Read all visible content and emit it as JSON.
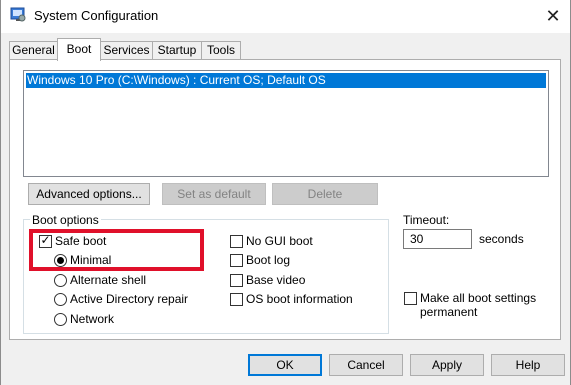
{
  "window": {
    "title": "System Configuration",
    "close_glyph": "✕",
    "icon": "msconfig-icon"
  },
  "tabs": [
    {
      "label": "General",
      "active": false
    },
    {
      "label": "Boot",
      "active": true
    },
    {
      "label": "Services",
      "active": false
    },
    {
      "label": "Startup",
      "active": false
    },
    {
      "label": "Tools",
      "active": false
    }
  ],
  "os_list": {
    "entries": [
      "Windows 10 Pro (C:\\Windows) : Current OS; Default OS"
    ],
    "selected_index": 0
  },
  "list_buttons": {
    "advanced": {
      "label": "Advanced options...",
      "enabled": true
    },
    "set_default": {
      "label": "Set as default",
      "enabled": false
    },
    "delete": {
      "label": "Delete",
      "enabled": false
    }
  },
  "boot_options": {
    "legend": "Boot options",
    "safe_boot": {
      "label": "Safe boot",
      "checked": true
    },
    "minimal": {
      "label": "Minimal",
      "selected": true
    },
    "alternate_shell": {
      "label": "Alternate shell",
      "selected": false
    },
    "ad_repair": {
      "label": "Active Directory repair",
      "selected": false
    },
    "network": {
      "label": "Network",
      "selected": false
    },
    "no_gui_boot": {
      "label": "No GUI boot",
      "checked": false
    },
    "boot_log": {
      "label": "Boot log",
      "checked": false
    },
    "base_video": {
      "label": "Base video",
      "checked": false
    },
    "os_boot_info": {
      "label": "OS boot information",
      "checked": false
    }
  },
  "timeout": {
    "label": "Timeout:",
    "value": "30",
    "unit": "seconds"
  },
  "make_permanent": {
    "label_line1": "Make all boot settings",
    "label_line2": "permanent",
    "checked": false
  },
  "dialog_buttons": {
    "ok": "OK",
    "cancel": "Cancel",
    "apply": "Apply",
    "help": "Help"
  },
  "colors": {
    "selection": "#0078d7",
    "highlight_box": "#e0102a"
  }
}
